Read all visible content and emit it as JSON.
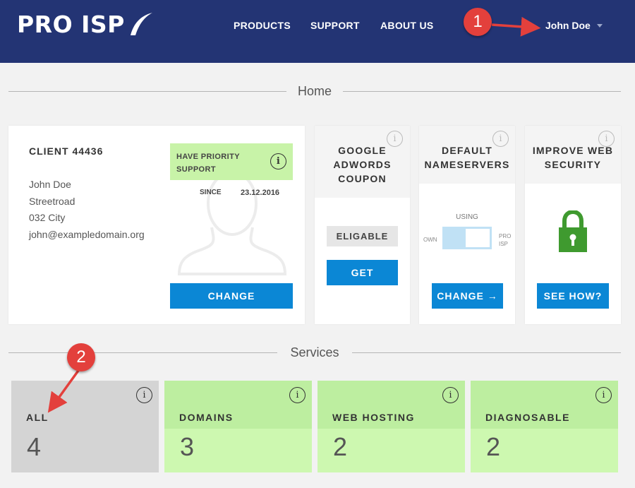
{
  "header": {
    "logo_text": "PRO ISP",
    "nav": [
      "PRODUCTS",
      "SUPPORT",
      "ABOUT US"
    ],
    "user_name": "John Doe"
  },
  "annotations": {
    "badge1": "1",
    "badge2": "2"
  },
  "sections": {
    "home": "Home",
    "services": "Services"
  },
  "client": {
    "title": "CLIENT 44436",
    "name": "John Doe",
    "street": "Streetroad",
    "city": "032 City",
    "email": "john@exampledomain.org",
    "priority_label": "HAVE PRIORITY SUPPORT",
    "since_label": "SINCE",
    "since_date": "23.12.2016",
    "change_label": "CHANGE"
  },
  "adwords": {
    "title": "GOOGLE ADWORDS COUPON",
    "status": "ELIGABLE",
    "get_label": "GET"
  },
  "nameservers": {
    "title": "DEFAULT NAMESERVERS",
    "using_label": "USING",
    "own_label": "OWN",
    "pro_label": "PRO ISP",
    "change_label": "CHANGE →"
  },
  "security": {
    "title": "IMPROVE WEB SECURITY",
    "button_label": "SEE HOW?"
  },
  "info_glyph": "i",
  "services": [
    {
      "label": "ALL",
      "count": "4"
    },
    {
      "label": "DOMAINS",
      "count": "3"
    },
    {
      "label": "WEB HOSTING",
      "count": "2"
    },
    {
      "label": "DIAGNOSABLE",
      "count": "2"
    }
  ],
  "colors": {
    "header_bg": "#233474",
    "button_blue": "#0b87d5",
    "priority_green": "#c8f3a8",
    "service_green": "#cdf8b0",
    "service_grey": "#d4d4d4",
    "annotation_red": "#e3403c",
    "lock_green": "#3f9a2f"
  },
  "icons": {
    "info": "info-circle-icon",
    "lock": "padlock-icon",
    "avatar": "user-silhouette-icon",
    "caret": "caret-down-icon"
  }
}
